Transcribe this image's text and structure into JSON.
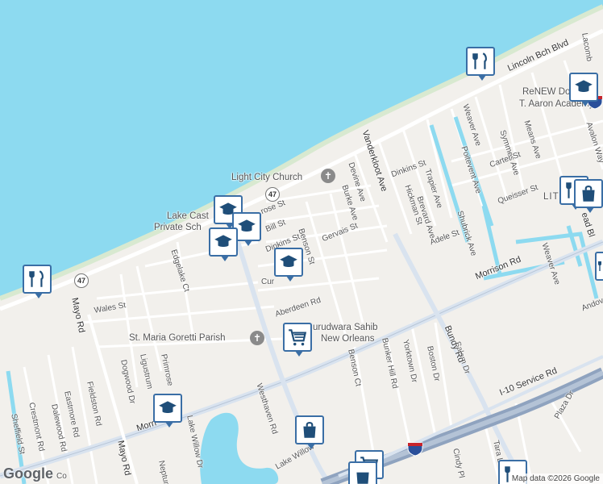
{
  "colors": {
    "water": "#8ddaf0",
    "land": "#f2f0ec",
    "highway": "#8fa3bf",
    "major_road": "#d9e3ef",
    "pin_border": "#3a6ea5",
    "pin_icon": "#1f4e79"
  },
  "streets": {
    "lincoln_bch_blvd": "Lincoln Bch Blvd",
    "lacombe": "Lacomb",
    "vanderkloot_ave": "Vanderkloot Ave",
    "devine_ave": "Devine Ave",
    "burke_ave": "Burke Ave",
    "dinkins_st_east": "Dinkins St",
    "trapier_ave": "Trapier Ave",
    "hickman_st": "Hickman St",
    "brevard_ave": "Brevard Ave",
    "poitevent_ave": "Poitevent Ave",
    "weaver_ave_north": "Weaver Ave",
    "means_ave": "Means Ave",
    "symmes_ave": "Symmes Ave",
    "carter_st": "Carter St",
    "avalon_way": "Avalon Way",
    "queisser_st": "Queisser St",
    "shubrick_ave": "Shubrick Ave",
    "adele_st": "Adele St",
    "morrison_rd": "Morrison Rd",
    "morrison_rd_west": "Morri",
    "weaver_ave_south": "Weaver Ave",
    "andover": "Andov",
    "read_blvd": "ead Bl",
    "rose_st": "rose St",
    "bill_st": "Bill St",
    "dinkins_st_west": "Dinkins St",
    "gervais_st": "Gervais St",
    "benson_st": "Benson St",
    "edgelake_ct": "Edgelake Ct",
    "cur": "Cur",
    "aberdeen_rd": "Aberdeen Rd",
    "wales_st": "Wales St",
    "mayo_rd_north": "Mayo Rd",
    "mayo_rd_south": "Mayo Rd",
    "fieldston_rd": "Fieldston Rd",
    "eastmore_rd": "Eastmore Rd",
    "dalewood_rd": "Dalewood Rd",
    "crestmont_rd": "Crestmont Rd",
    "sheffield_st": "Sheffield St",
    "dogwood_dr": "Dogwood Dr",
    "ligustrum": "Ligustrum",
    "primrose": "Primrose",
    "lake_willow_dr": "Lake Willow Dr",
    "lake_willow_south": "Lake Willow",
    "neptune": "Neptune",
    "westhaven_rd": "Westhaven Rd",
    "benson_ct": "Benson Ct",
    "bunker_hill_rd": "Bunker Hill Rd",
    "yorktown_dr": "Yorktown Dr",
    "boston_dr": "Boston Dr",
    "salem_dr": "Salem Dr",
    "bundy_rd": "Bundy Rd",
    "i10_service_rd": "I-10 Service Rd",
    "plaza_dr": "Plaza Dr",
    "tara_ln": "Tara Ln",
    "cindy_pl": "Cindy Pl",
    "co": "Co"
  },
  "places": {
    "light_city_church": "Light City Church",
    "lake_castle_1": "Lake Cast",
    "lake_castle_2": "Private Sch",
    "st_maria_goretti": "St. Maria Goretti Parish",
    "gurudwara_1": "urudwara Sahib",
    "gurudwara_2": "New Orleans",
    "renew_1": "ReNEW Dol",
    "renew_2": "T. Aaron Academy",
    "little": "LIT"
  },
  "route_shields": {
    "hwy47_north": "47",
    "hwy47_west": "47"
  },
  "logo": "Google",
  "attribution": "Map data ©2026 Google"
}
